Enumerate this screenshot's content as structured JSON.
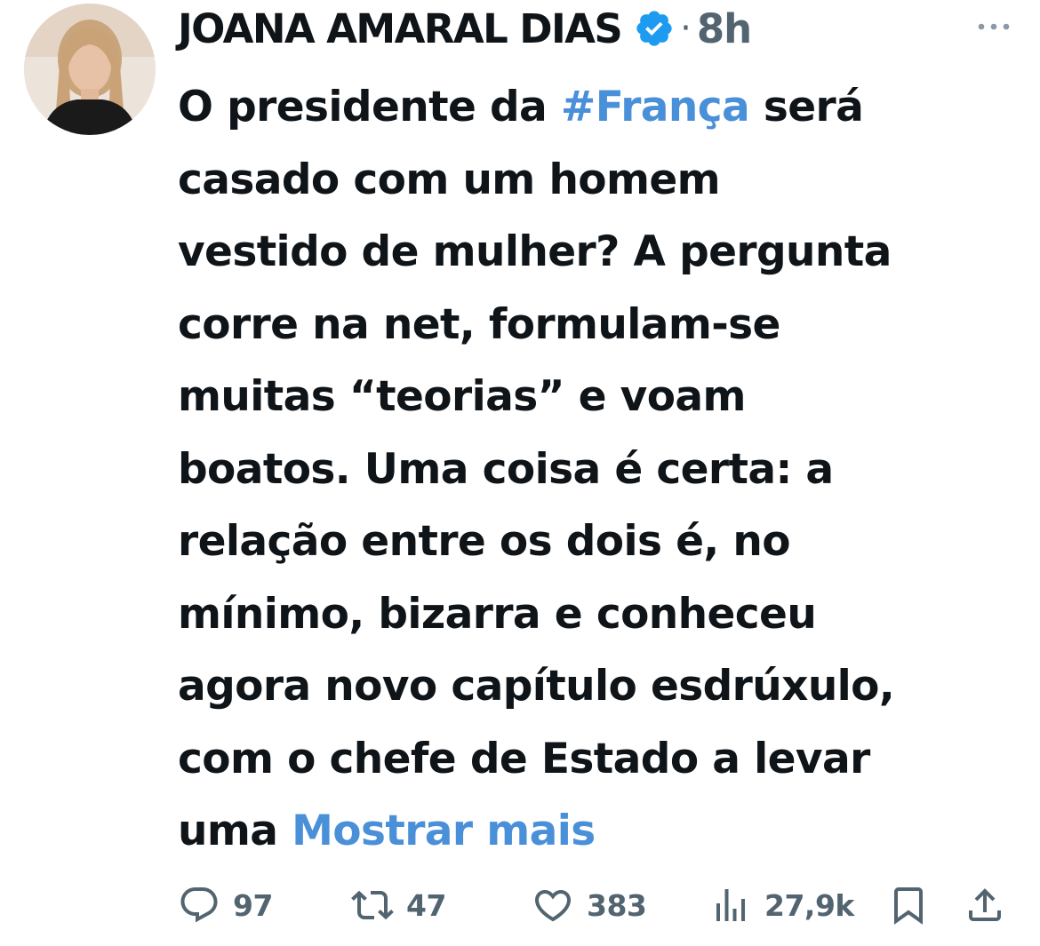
{
  "author": {
    "name": "JOANA AMARAL DIAS",
    "verified": true,
    "time": "8h",
    "separator": "·"
  },
  "tweet": {
    "lines": [
      [
        "O presidente da ",
        "#França",
        " será"
      ],
      [
        "casado com um homem"
      ],
      [
        "vestido de mulher? A pergunta"
      ],
      [
        "corre na net, formulam-se"
      ],
      [
        "muitas “teorias” e voam"
      ],
      [
        "boatos. Uma coisa é certa: a"
      ],
      [
        "relação entre os dois é, no"
      ],
      [
        "mínimo, bizarra e conheceu"
      ],
      [
        "agora novo capítulo esdrúxulo,"
      ],
      [
        "com o chefe de Estado a levar"
      ],
      [
        "uma ",
        "Mostrar mais"
      ]
    ]
  },
  "actions": {
    "replies": "97",
    "retweets": "47",
    "likes": "383",
    "views": "27,9k"
  },
  "colors": {
    "text": "#0f1419",
    "secondary": "#536471",
    "link": "#4a90d9",
    "verified_badge": "#1d9bf0"
  },
  "icons": {
    "reply": "speech-bubble",
    "retweet": "retweet-arrows",
    "like": "heart",
    "views": "bar-chart",
    "bookmark": "bookmark",
    "share": "upload-arrow",
    "more": "ellipsis"
  }
}
